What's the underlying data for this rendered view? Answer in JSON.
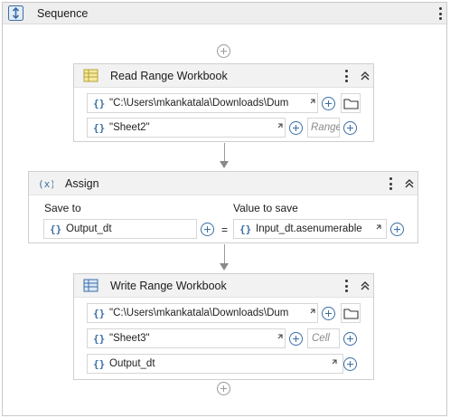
{
  "sequence": {
    "title": "Sequence"
  },
  "read_range": {
    "title": "Read Range Workbook",
    "workbook_path": "\"C:\\Users\\mkankatala\\Downloads\\Dum",
    "sheet_name": "\"Sheet2\"",
    "range_placeholder": "Range"
  },
  "assign": {
    "title": "Assign",
    "save_to_label": "Save to",
    "value_label": "Value to save",
    "save_to_value": "Output_dt",
    "equals": "=",
    "value_expression": "Input_dt.asenumerable"
  },
  "write_range": {
    "title": "Write Range Workbook",
    "workbook_path": "\"C:\\Users\\mkankatala\\Downloads\\Dum",
    "sheet_name": "\"Sheet3\"",
    "cell_placeholder": "Cell",
    "datatable_value": "Output_dt"
  },
  "field_prefix": "{}",
  "colors": {
    "accent": "#3a6ea5",
    "header_bg": "#f2f2f2",
    "border": "#cfcfcf"
  }
}
